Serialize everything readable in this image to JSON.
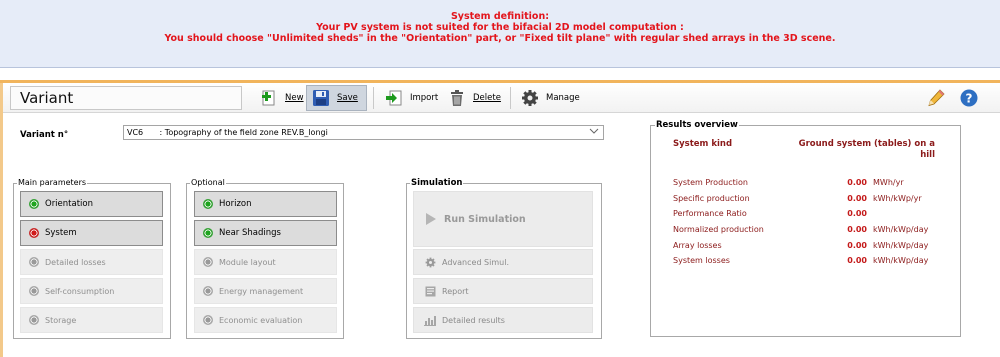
{
  "alert": {
    "line1": "System definition:",
    "line2": "Your PV system is not suited for the bifacial 2D model computation :",
    "line3": "You should choose \"Unlimited sheds\" in the \"Orientation\" part, or \"Fixed tilt plane\" with regular shed arrays in the 3D scene."
  },
  "toolbar": {
    "title": "Variant",
    "new_label": "New",
    "save_label": "Save",
    "import_label": "Import",
    "delete_label": "Delete",
    "manage_label": "Manage"
  },
  "variant": {
    "label": "Variant n°",
    "code": "VC6",
    "name": ": Topography of the field zone REV.B_longi"
  },
  "main_parameters": {
    "title": "Main parameters",
    "items": [
      {
        "label": "Orientation",
        "status": "green"
      },
      {
        "label": "System",
        "status": "red"
      },
      {
        "label": "Detailed losses",
        "status": "grey"
      },
      {
        "label": "Self-consumption",
        "status": "grey"
      },
      {
        "label": "Storage",
        "status": "grey"
      }
    ]
  },
  "optional": {
    "title": "Optional",
    "items": [
      {
        "label": "Horizon",
        "status": "green"
      },
      {
        "label": "Near Shadings",
        "status": "green"
      },
      {
        "label": "Module layout",
        "status": "grey"
      },
      {
        "label": "Energy management",
        "status": "grey"
      },
      {
        "label": "Economic evaluation",
        "status": "grey"
      }
    ]
  },
  "simulation": {
    "title": "Simulation",
    "run_label": "Run Simulation",
    "advanced_label": "Advanced Simul.",
    "report_label": "Report",
    "detailed_label": "Detailed results"
  },
  "results": {
    "title": "Results overview",
    "system_kind_label": "System kind",
    "system_kind_value": "Ground system (tables) on a hill",
    "rows": [
      {
        "label": "System Production",
        "value": "0.00",
        "unit": "MWh/yr"
      },
      {
        "label": "Specific production",
        "value": "0.00",
        "unit": "kWh/kWp/yr"
      },
      {
        "label": "Performance Ratio",
        "value": "0.00",
        "unit": ""
      },
      {
        "label": "Normalized production",
        "value": "0.00",
        "unit": "kWh/kWp/day"
      },
      {
        "label": "Array losses",
        "value": "0.00",
        "unit": "kWh/kWp/day"
      },
      {
        "label": "System losses",
        "value": "0.00",
        "unit": "kWh/kWp/day"
      }
    ]
  },
  "colors": {
    "alert_text": "#e3141b",
    "alert_bg": "#e6ecf8",
    "results_label": "#8b1a1a",
    "results_value": "#c41a1a",
    "status_ok": "#1fa51f",
    "status_error": "#d01c1c",
    "accent_bar": "#f1b45c"
  }
}
